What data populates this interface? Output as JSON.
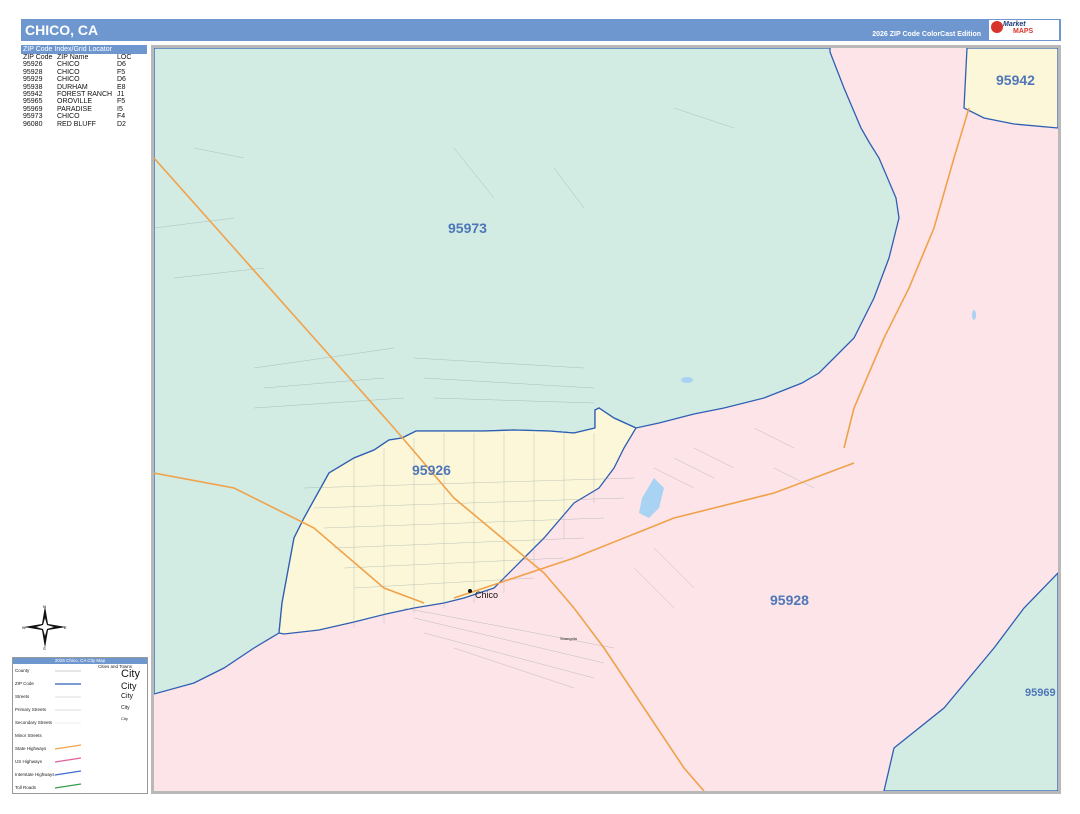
{
  "header": {
    "title": "CHICO, CA",
    "edition": "2026 ZIP Code ColorCast Edition",
    "logo_text": "Market",
    "logo_sub": "MAPS"
  },
  "index": {
    "title": "ZIP Code Index/Grid Locator",
    "columns": [
      "ZIP Code",
      "ZIP Name",
      "LOC"
    ],
    "rows": [
      [
        "95926",
        "CHICO",
        "D6"
      ],
      [
        "95928",
        "CHICO",
        "F5"
      ],
      [
        "95929",
        "CHICO",
        "D6"
      ],
      [
        "95938",
        "DURHAM",
        "E8"
      ],
      [
        "95942",
        "FOREST RANCH",
        "J1"
      ],
      [
        "95965",
        "OROVILLE",
        "F5"
      ],
      [
        "95969",
        "PARADISE",
        "I5"
      ],
      [
        "95973",
        "CHICO",
        "F4"
      ],
      [
        "96080",
        "RED BLUFF",
        "D2"
      ]
    ]
  },
  "map": {
    "zip_labels": {
      "z95973": "95973",
      "z95926": "95926",
      "z95928": "95928",
      "z95942": "95942",
      "z95969": "95969"
    },
    "city_label": "Chico",
    "place_label": "Shangrila",
    "colors": {
      "green": "#d2ebe3",
      "yellow": "#fbf7d8",
      "pink": "#fce4e8",
      "zip_border": "#2f5fb3",
      "zip_label": "#4f77b8",
      "highway": "#f0a24b"
    }
  },
  "compass": {
    "n": "N",
    "s": "S",
    "e": "E",
    "w": "W"
  },
  "legend": {
    "title": "2026 Chico, CA City Map",
    "cities_title": "Cities and Towns",
    "items": [
      "County",
      "ZIP Code",
      "Streets",
      "Primary Streets",
      "Secondary Streets",
      "Minor Streets",
      "State Highways",
      "US Highways",
      "Interstate Highways",
      "Toll Roads"
    ],
    "city_samples": [
      "City",
      "City",
      "City",
      "City",
      "City"
    ]
  }
}
